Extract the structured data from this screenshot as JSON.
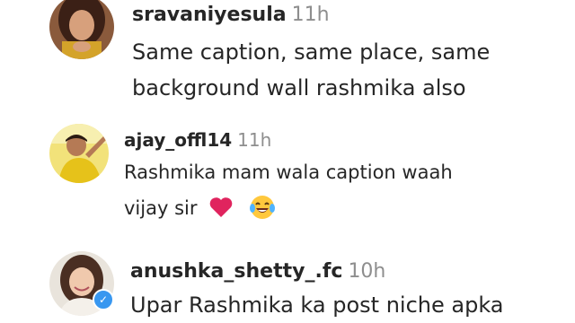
{
  "comments": [
    {
      "username": "sravaniyesula",
      "time": "11h",
      "text_line1": "Same caption, same place, same",
      "text_line2": "background wall rashmika also",
      "avatar_icon": "woman-portrait-avatar"
    },
    {
      "username": "ajay_offl14",
      "time": "11h",
      "text_line1": "Rashmika mam wala caption waah",
      "text_line2": "vijay sir",
      "emojis": [
        "red-heart-emoji",
        "laughing-tears-emoji"
      ],
      "avatar_icon": "man-yellow-shirt-avatar"
    },
    {
      "username": "anushka_shetty_.fc",
      "time": "10h",
      "text_line1": "Upar Rashmika ka post niche apka",
      "avatar_icon": "woman-smiling-avatar",
      "verified_icon": "verified-badge-icon"
    }
  ],
  "colors": {
    "username": "#262626",
    "time": "#8e8e8e",
    "verified": "#3897f0",
    "heart": "#e0245e"
  }
}
